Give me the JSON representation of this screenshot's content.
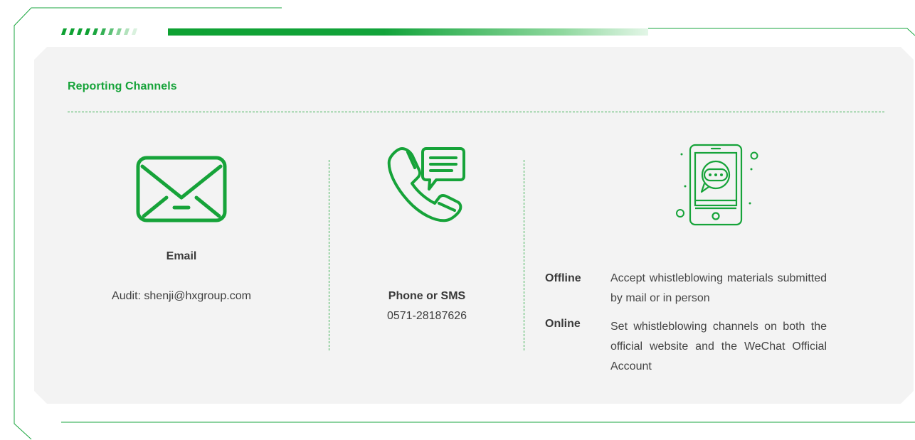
{
  "section": {
    "title": "Reporting Channels"
  },
  "email": {
    "icon": "envelope-icon",
    "title": "Email",
    "detail": "Audit: shenji@hxgroup.com"
  },
  "phone": {
    "icon": "phone-chat-icon",
    "title": "Phone or SMS",
    "number": "0571-28187626"
  },
  "channels": {
    "icon": "smartphone-message-icon",
    "items": [
      {
        "term": "Offline",
        "description": "Accept whistleblowing materials submitted by mail or in person"
      },
      {
        "term": "Online",
        "description": "Set whistleblowing channels on both the official website and the WeChat Official Account"
      }
    ]
  },
  "colors": {
    "accent": "#16a339",
    "panel": "#f3f3f3",
    "text": "#3a3a3a"
  }
}
